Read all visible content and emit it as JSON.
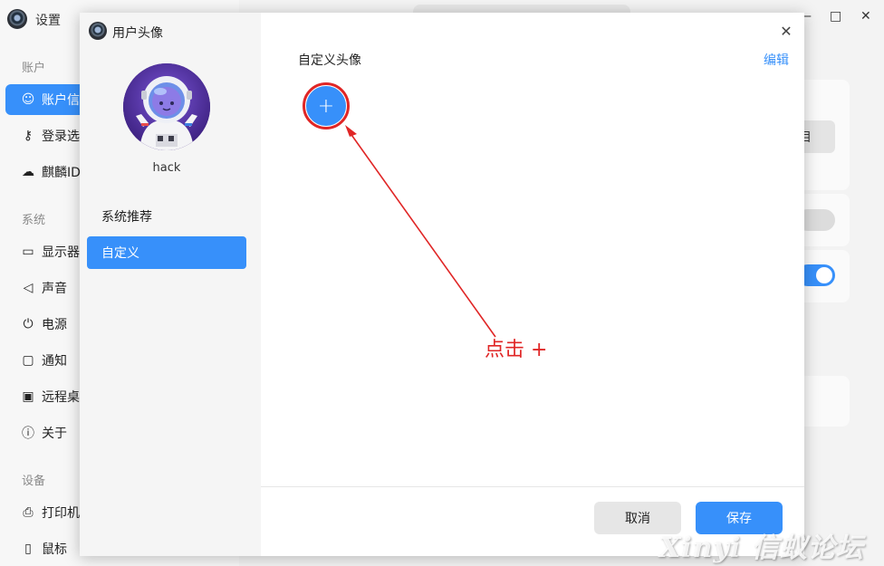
{
  "background": {
    "app_title": "设置",
    "sections": [
      {
        "label": "账户"
      },
      {
        "label": "系统"
      },
      {
        "label": "设备"
      }
    ],
    "items": [
      {
        "label": "账户信息",
        "icon": "user-icon"
      },
      {
        "label": "登录选项",
        "icon": "key-icon"
      },
      {
        "label": "麒麟ID",
        "icon": "cloud-icon"
      },
      {
        "label": "显示器",
        "icon": "monitor-icon"
      },
      {
        "label": "声音",
        "icon": "speaker-icon"
      },
      {
        "label": "电源",
        "icon": "power-icon"
      },
      {
        "label": "通知",
        "icon": "message-icon"
      },
      {
        "label": "远程桌面",
        "icon": "remote-desktop-icon"
      },
      {
        "label": "关于",
        "icon": "info-icon"
      },
      {
        "label": "打印机",
        "icon": "printer-icon"
      },
      {
        "label": "鼠标",
        "icon": "mouse-icon"
      }
    ],
    "partial_button": "目"
  },
  "dialog": {
    "title": "用户头像",
    "username": "hack",
    "categories": [
      {
        "label": "系统推荐",
        "active": false
      },
      {
        "label": "自定义",
        "active": true
      }
    ],
    "section_title": "自定义头像",
    "edit_label": "编辑",
    "add_label": "+",
    "cancel_label": "取消",
    "save_label": "保存"
  },
  "annotation": {
    "text": "点击 +",
    "color": "#e02626"
  },
  "watermark": "Xinyi 信蚁论坛",
  "colors": {
    "accent": "#3790fa",
    "annotation": "#e02626"
  }
}
